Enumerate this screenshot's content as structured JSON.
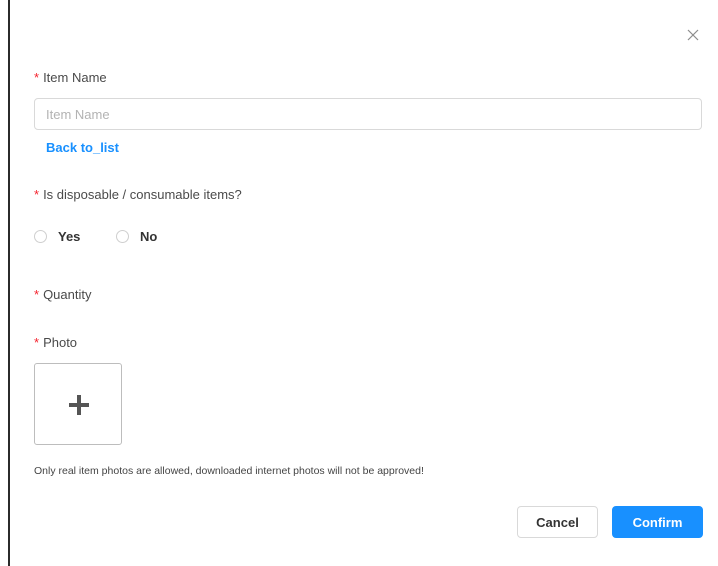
{
  "form": {
    "item_name": {
      "required_mark": "*",
      "label": "Item Name",
      "placeholder": "Item Name",
      "value": ""
    },
    "back_link": "Back to_list",
    "disposable": {
      "required_mark": "*",
      "label": "Is disposable / consumable items?",
      "options": [
        {
          "label": "Yes",
          "selected": false
        },
        {
          "label": "No",
          "selected": false
        }
      ]
    },
    "quantity": {
      "required_mark": "*",
      "label": "Quantity"
    },
    "photo": {
      "required_mark": "*",
      "label": "Photo",
      "upload_icon": "plus-icon",
      "hint": "Only real item photos are allowed, downloaded internet photos will not be approved!"
    }
  },
  "footer": {
    "cancel_label": "Cancel",
    "confirm_label": "Confirm"
  },
  "icons": {
    "close": "close-icon"
  },
  "colors": {
    "required": "#f5222d",
    "primary": "#1890ff",
    "link": "#1890ff",
    "border": "#d9d9d9"
  }
}
